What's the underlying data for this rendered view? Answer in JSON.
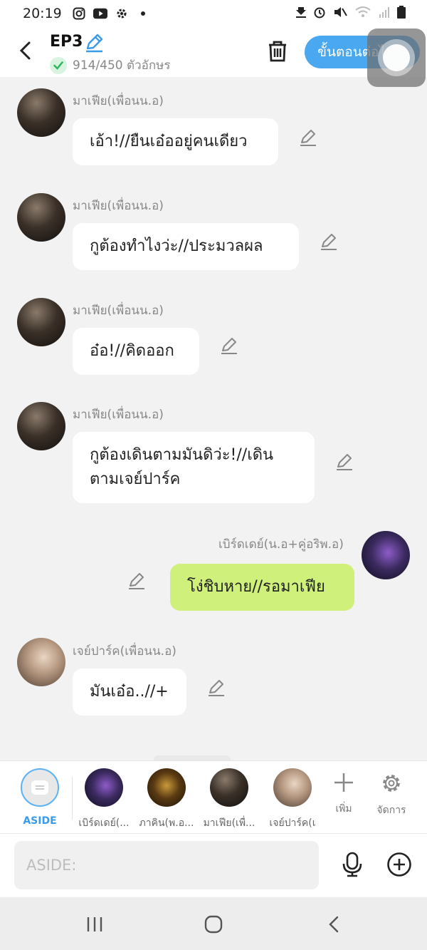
{
  "status_bar": {
    "time": "20:19",
    "left_icons": [
      "instagram-icon",
      "youtube-icon",
      "settings-icon",
      "dot-icon"
    ],
    "right_icons": [
      "download-icon",
      "alarm-icon",
      "mute-icon",
      "wifi-icon",
      "signal-icon",
      "battery-icon"
    ]
  },
  "header": {
    "title": "EP3",
    "char_count": "914/450 ตัวอักษร",
    "next_button": "ขั้นตอนต่อไป"
  },
  "messages": [
    {
      "sender": "มาเฟีย(เพื่อนน.อ)",
      "lines": [
        "เอ้า!//ยืนเอ๋ออยู่คนเดียว"
      ],
      "side": "left"
    },
    {
      "sender": "มาเฟีย(เพื่อนน.อ)",
      "lines": [
        "กูต้องทำไงว่ะ//ประมวลผล"
      ],
      "side": "left"
    },
    {
      "sender": "มาเฟีย(เพื่อนน.อ)",
      "lines": [
        "อ๋อ!//คิดออก"
      ],
      "side": "left"
    },
    {
      "sender": "มาเฟีย(เพื่อนน.อ)",
      "lines": [
        "กูต้องเดินตามมันดิว่ะ!//เดิน",
        "ตามเจย์ปาร์ค"
      ],
      "side": "left"
    },
    {
      "sender": "เบิร์ดเดย์(น.อ+คู่อริพ.อ)",
      "lines": [
        "โง่ชิบหาย//รอมาเฟีย"
      ],
      "side": "right"
    },
    {
      "sender": "เจย์ปาร์ค(เพื่อนน.อ)",
      "lines": [
        "มันเอ๋อ..//+"
      ],
      "side": "left"
    }
  ],
  "characters": [
    {
      "label": "ASIDE",
      "selected": true
    },
    {
      "label": "เบิร์ดเดย์(..."
    },
    {
      "label": "ภาคิน(พ.อ..."
    },
    {
      "label": "มาเฟีย(เพื่..."
    },
    {
      "label": "เจย์ปาร์ค(เ"
    }
  ],
  "tools": {
    "add_label": "เพิ่ม",
    "manage_label": "จัดการ"
  },
  "input": {
    "placeholder": "ASIDE:",
    "value": ""
  },
  "colors": {
    "accent": "#4aa8f0",
    "my_bubble": "#cff07a",
    "other_bubble": "#ffffff",
    "background": "#f2f2f2"
  }
}
